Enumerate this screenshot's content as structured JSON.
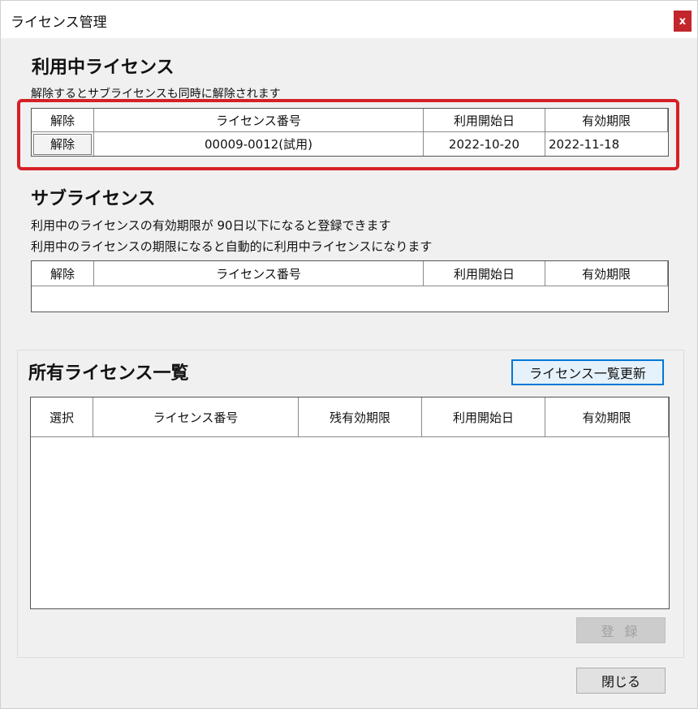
{
  "window": {
    "title": "ライセンス管理",
    "close_label": "x"
  },
  "active_license": {
    "heading": "利用中ライセンス",
    "note": "解除するとサブライセンスも同時に解除されます",
    "columns": [
      "解除",
      "ライセンス番号",
      "利用開始日",
      "有効期限"
    ],
    "rows": [
      {
        "action_label": "解除",
        "license_number": "00009-0012(試用)",
        "start_date": "2022-10-20",
        "expiry_date": "2022-11-18"
      }
    ]
  },
  "sub_license": {
    "heading": "サブライセンス",
    "note_1": "利用中のライセンスの有効期限が 90日以下になると登録できます",
    "note_2": "利用中のライセンスの期限になると自動的に利用中ライセンスになります",
    "columns": [
      "解除",
      "ライセンス番号",
      "利用開始日",
      "有効期限"
    ]
  },
  "owned_licenses": {
    "heading": "所有ライセンス一覧",
    "refresh_label": "ライセンス一覧更新",
    "columns": [
      "選択",
      "ライセンス番号",
      "残有効期限",
      "利用開始日",
      "有効期限"
    ],
    "register_label": "登 録"
  },
  "footer": {
    "close_label": "閉じる"
  },
  "colors": {
    "highlight": "#d62027",
    "close_button": "#c2252c",
    "primary_border": "#0078d7"
  }
}
